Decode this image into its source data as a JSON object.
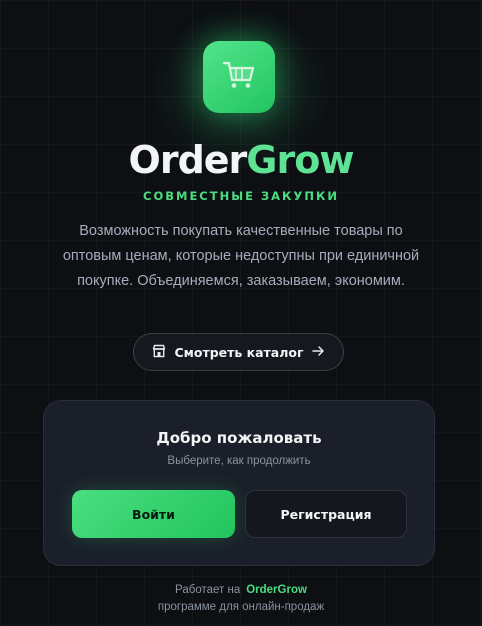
{
  "logo": {
    "icon": "shopping-cart-icon",
    "accent": "#22c55e"
  },
  "brand": {
    "name_part1": "Order",
    "name_part2": "Grow"
  },
  "tagline": "СОВМЕСТНЫЕ ЗАКУПКИ",
  "description": "Возможность покупать качественные товары по оптовым ценам, которые недоступны при единичной покупке. Объединяемся, заказываем, экономим.",
  "catalog_button": {
    "label": "Смотреть каталог",
    "icon": "store-icon",
    "trailing_icon": "arrow-right-icon"
  },
  "welcome_card": {
    "title": "Добро пожаловать",
    "subtitle": "Выберите, как продолжить",
    "login_label": "Войти",
    "register_label": "Регистрация"
  },
  "footer": {
    "powered_prefix": "Работает на",
    "powered_brand": "OrderGrow",
    "powered_suffix": "программе для онлайн-продаж"
  },
  "colors": {
    "background": "#0d0f13",
    "accent": "#4ade80",
    "card": "#1b1f29"
  }
}
